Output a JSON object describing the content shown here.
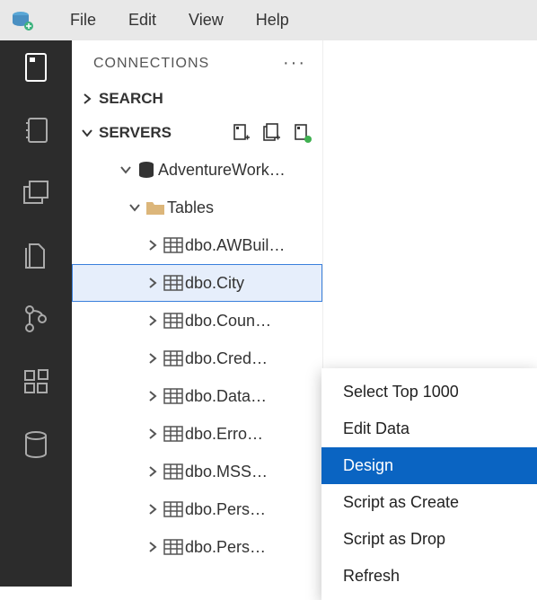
{
  "menubar": {
    "items": [
      "File",
      "Edit",
      "View",
      "Help"
    ]
  },
  "activity": {
    "icons": [
      "server-icon",
      "notebook-icon",
      "windows-icon",
      "files-icon",
      "source-control-icon",
      "extensions-icon",
      "database-icon"
    ]
  },
  "panel": {
    "title": "CONNECTIONS",
    "search_label": "SEARCH",
    "servers_label": "SERVERS"
  },
  "tree": {
    "db": "AdventureWork…",
    "folder": "Tables",
    "tables": [
      "dbo.AWBuil…",
      "dbo.City",
      "dbo.Coun…",
      "dbo.Cred…",
      "dbo.Data…",
      "dbo.Erro…",
      "dbo.MSS…",
      "dbo.Pers…",
      "dbo.Pers…"
    ],
    "selected_index": 1
  },
  "context_menu": {
    "items": [
      "Select Top 1000",
      "Edit Data",
      "Design",
      "Script as Create",
      "Script as Drop",
      "Refresh"
    ],
    "highlight_index": 2
  }
}
